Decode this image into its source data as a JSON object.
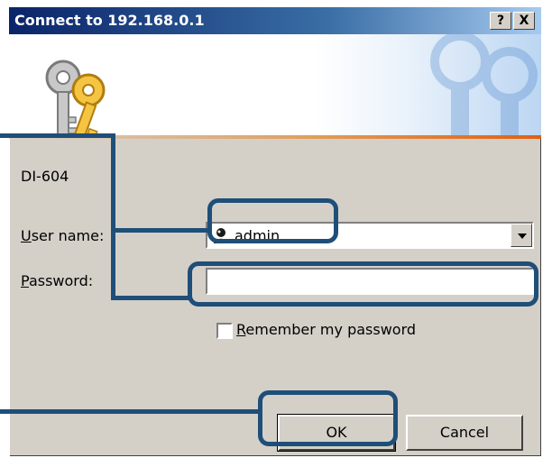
{
  "window": {
    "title": "Connect to 192.168.0.1",
    "help_button": "?",
    "close_button": "X"
  },
  "form": {
    "device_label": "DI-604",
    "username_label_accel": "U",
    "username_label_rest": "ser name:",
    "username_value": "admin",
    "password_label_accel": "P",
    "password_label_rest": "assword:",
    "password_value": "",
    "remember_accel": "R",
    "remember_rest": "emember my password",
    "remember_checked": false
  },
  "buttons": {
    "ok": "OK",
    "cancel": "Cancel"
  },
  "colors": {
    "titlebar": "#0a246a",
    "callout": "#1f4e79",
    "window_face": "#d4d0c8"
  },
  "icons": [
    "keys-icon",
    "user-icon",
    "dropdown-arrow-icon",
    "help-icon",
    "close-icon"
  ]
}
